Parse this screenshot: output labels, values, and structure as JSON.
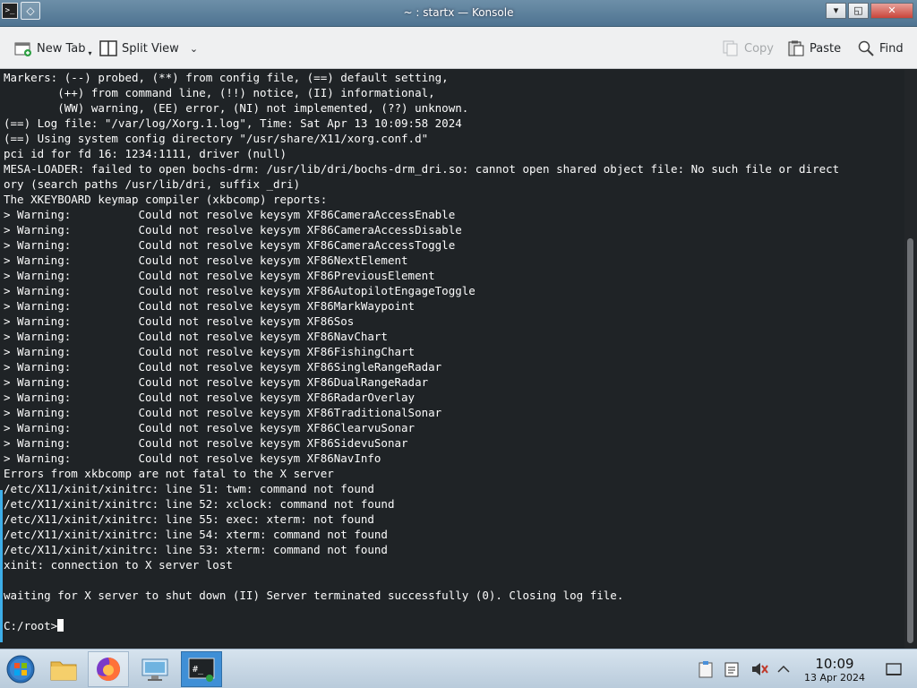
{
  "window": {
    "title": "~ : startx — Konsole",
    "minimize_label": "▾",
    "restore_label": "◱",
    "close_label": "✕"
  },
  "toolbar": {
    "new_tab": "New Tab",
    "split_view": "Split View",
    "copy": "Copy",
    "paste": "Paste",
    "find": "Find"
  },
  "terminal": {
    "lines": [
      "Markers: (--) probed, (**) from config file, (==) default setting,",
      "        (++) from command line, (!!) notice, (II) informational,",
      "        (WW) warning, (EE) error, (NI) not implemented, (??) unknown.",
      "(==) Log file: \"/var/log/Xorg.1.log\", Time: Sat Apr 13 10:09:58 2024",
      "(==) Using system config directory \"/usr/share/X11/xorg.conf.d\"",
      "pci id for fd 16: 1234:1111, driver (null)",
      "MESA-LOADER: failed to open bochs-drm: /usr/lib/dri/bochs-drm_dri.so: cannot open shared object file: No such file or direct",
      "ory (search paths /usr/lib/dri, suffix _dri)",
      "The XKEYBOARD keymap compiler (xkbcomp) reports:",
      "> Warning:          Could not resolve keysym XF86CameraAccessEnable",
      "> Warning:          Could not resolve keysym XF86CameraAccessDisable",
      "> Warning:          Could not resolve keysym XF86CameraAccessToggle",
      "> Warning:          Could not resolve keysym XF86NextElement",
      "> Warning:          Could not resolve keysym XF86PreviousElement",
      "> Warning:          Could not resolve keysym XF86AutopilotEngageToggle",
      "> Warning:          Could not resolve keysym XF86MarkWaypoint",
      "> Warning:          Could not resolve keysym XF86Sos",
      "> Warning:          Could not resolve keysym XF86NavChart",
      "> Warning:          Could not resolve keysym XF86FishingChart",
      "> Warning:          Could not resolve keysym XF86SingleRangeRadar",
      "> Warning:          Could not resolve keysym XF86DualRangeRadar",
      "> Warning:          Could not resolve keysym XF86RadarOverlay",
      "> Warning:          Could not resolve keysym XF86TraditionalSonar",
      "> Warning:          Could not resolve keysym XF86ClearvuSonar",
      "> Warning:          Could not resolve keysym XF86SidevuSonar",
      "> Warning:          Could not resolve keysym XF86NavInfo",
      "Errors from xkbcomp are not fatal to the X server",
      "/etc/X11/xinit/xinitrc: line 51: twm: command not found",
      "/etc/X11/xinit/xinitrc: line 52: xclock: command not found",
      "/etc/X11/xinit/xinitrc: line 55: exec: xterm: not found",
      "/etc/X11/xinit/xinitrc: line 54: xterm: command not found",
      "/etc/X11/xinit/xinitrc: line 53: xterm: command not found",
      "xinit: connection to X server lost",
      "",
      "waiting for X server to shut down (II) Server terminated successfully (0). Closing log file.",
      "",
      "C:/root>"
    ]
  },
  "taskbar": {
    "clock_time": "10:09",
    "clock_date": "13 Apr 2024",
    "tasks": [
      "start-orb",
      "file-manager",
      "firefox",
      "remote-desktop",
      "konsole"
    ]
  },
  "colors": {
    "terminal_bg": "#1f2326",
    "terminal_fg": "#fcfcfc",
    "accent": "#3daee9"
  }
}
